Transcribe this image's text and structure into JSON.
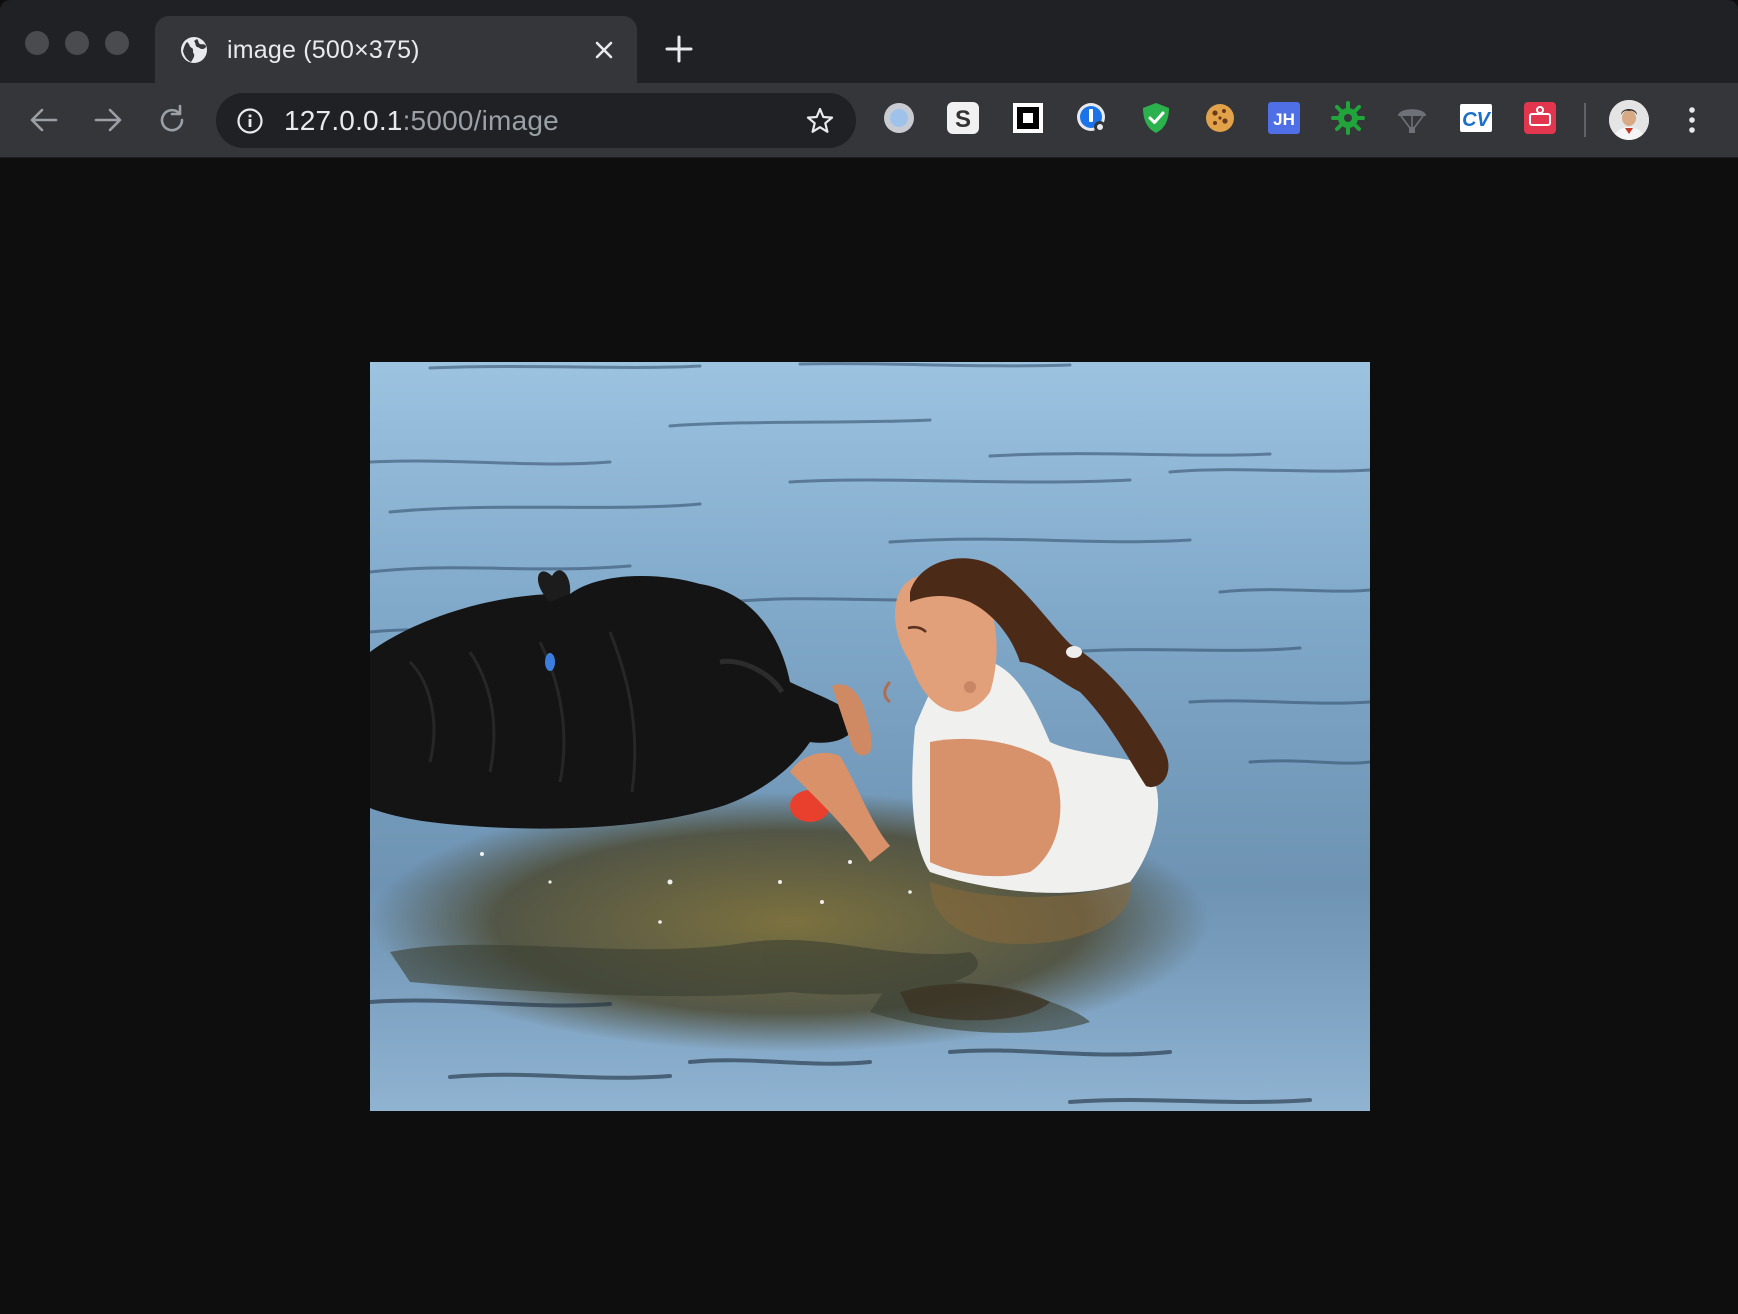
{
  "window": {
    "controls": [
      "close",
      "minimize",
      "zoom"
    ]
  },
  "tab": {
    "title": "image (500×375)",
    "icon": "globe-icon",
    "close_icon": "close-icon"
  },
  "newtab": {
    "icon": "plus-icon"
  },
  "toolbar": {
    "back_icon": "arrow-left-icon",
    "forward_icon": "arrow-right-icon",
    "reload_icon": "reload-icon",
    "url_host": "127.0.0.1",
    "url_rest": ":5000/image",
    "info_icon": "info-icon",
    "bookmark_icon": "star-icon",
    "extensions": [
      {
        "name": "circle-extension-icon"
      },
      {
        "name": "s-extension-icon",
        "label": "S"
      },
      {
        "name": "square-extension-icon"
      },
      {
        "name": "password-extension-icon"
      },
      {
        "name": "shield-extension-icon"
      },
      {
        "name": "cookie-extension-icon"
      },
      {
        "name": "jh-extension-icon",
        "label": "JH"
      },
      {
        "name": "gear-bug-extension-icon"
      },
      {
        "name": "parachute-extension-icon"
      },
      {
        "name": "cv-extension-icon",
        "label": "CV"
      },
      {
        "name": "red-app-extension-icon"
      }
    ],
    "profile": "avatar",
    "menu_icon": "kebab-menu-icon"
  },
  "content": {
    "image_description_alt": "image"
  },
  "colors": {
    "tabstrip": "#202124",
    "toolbar": "#35363a",
    "page_background": "#0e0e0e",
    "text": "#e8eaed",
    "muted_text": "#9aa0a6"
  }
}
